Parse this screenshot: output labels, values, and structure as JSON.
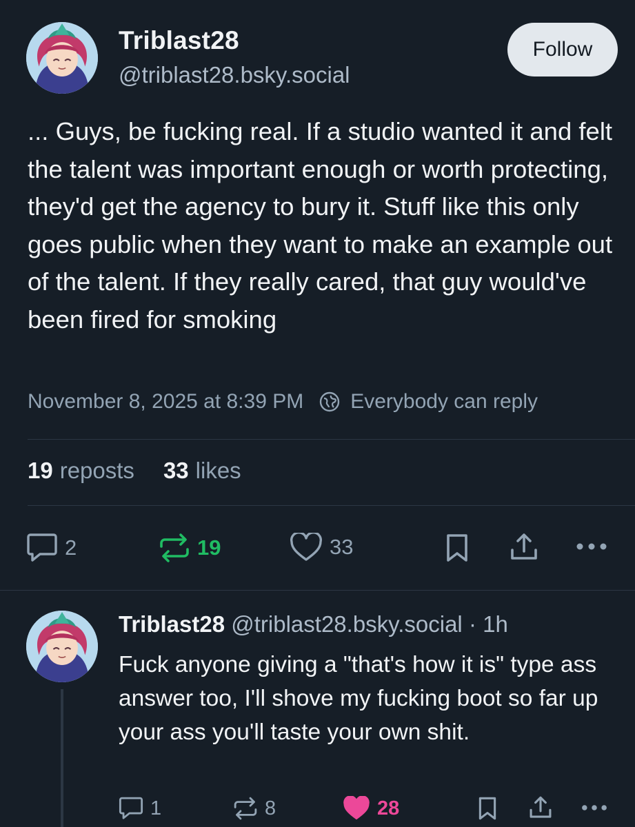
{
  "post": {
    "author_name": "Triblast28",
    "author_handle": "@triblast28.bsky.social",
    "follow_label": "Follow",
    "text": "... Guys, be fucking real. If a studio wanted it and felt the talent was important enough or worth protecting, they'd get the agency to bury it. Stuff like this only goes public when they want to make an example out of the talent. If they really cared, that guy would've been fired for smoking",
    "timestamp": "November 8, 2025 at 8:39 PM",
    "reply_setting": "Everybody can reply",
    "reposts_count": "19",
    "reposts_label": "reposts",
    "likes_count": "33",
    "likes_label": "likes",
    "actions": {
      "replies": "2",
      "reposts": "19",
      "likes": "33"
    }
  },
  "reply": {
    "author_name": "Triblast28",
    "author_handle": "@triblast28.bsky.social",
    "time": "· 1h",
    "text": "Fuck anyone giving a \"that's how it is\" type ass answer too, I'll shove my fucking boot so far up your ass you'll taste your own shit.",
    "actions": {
      "replies": "1",
      "reposts": "8",
      "likes": "28"
    }
  },
  "colors": {
    "background": "#161e27",
    "repost_active": "#20bc63",
    "like_active": "#ec4899",
    "muted": "#93a4b4"
  },
  "icons": [
    "speech-bubble-icon",
    "repost-icon",
    "heart-icon",
    "bookmark-icon",
    "share-icon",
    "more-icon",
    "globe-icon"
  ]
}
